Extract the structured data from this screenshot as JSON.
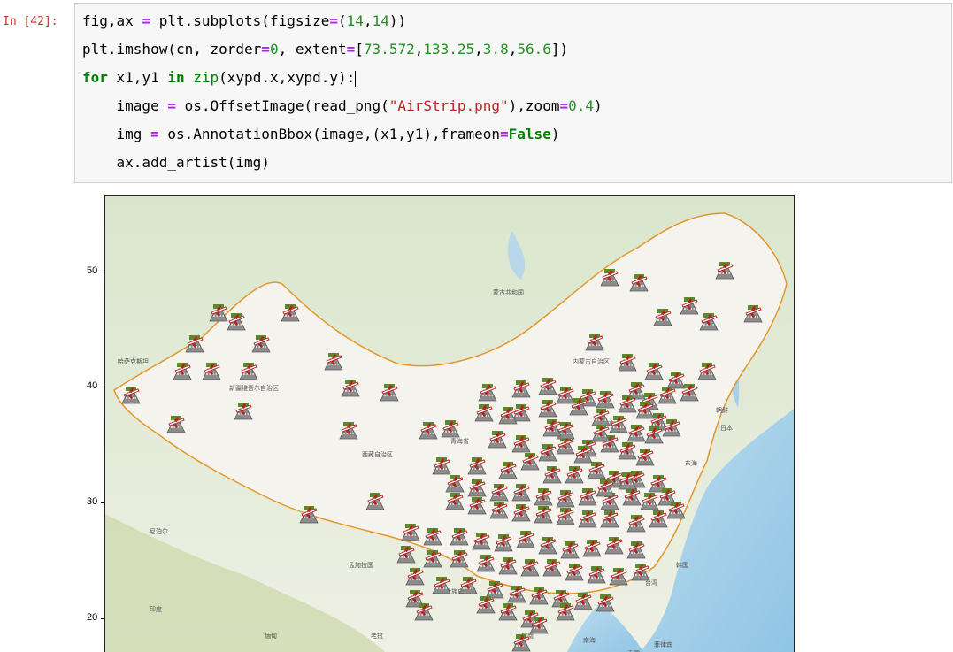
{
  "notebook": {
    "prompt": "In [42]:",
    "code_lines": [
      [
        {
          "t": "fig,ax "
        },
        {
          "t": "=",
          "c": "o"
        },
        {
          "t": " plt.subplots(figsize"
        },
        {
          "t": "=",
          "c": "o"
        },
        {
          "t": "("
        },
        {
          "t": "14",
          "c": "num"
        },
        {
          "t": ","
        },
        {
          "t": "14",
          "c": "num"
        },
        {
          "t": "))"
        }
      ],
      [
        {
          "t": "plt.imshow(cn, zorder"
        },
        {
          "t": "=",
          "c": "o"
        },
        {
          "t": "0",
          "c": "num"
        },
        {
          "t": ", extent"
        },
        {
          "t": "=",
          "c": "o"
        },
        {
          "t": "["
        },
        {
          "t": "73.572",
          "c": "num"
        },
        {
          "t": ","
        },
        {
          "t": "133.25",
          "c": "num"
        },
        {
          "t": ","
        },
        {
          "t": "3.8",
          "c": "num"
        },
        {
          "t": ","
        },
        {
          "t": "56.6",
          "c": "num"
        },
        {
          "t": "])"
        }
      ],
      [
        {
          "t": "for",
          "c": "k"
        },
        {
          "t": " x1,y1 "
        },
        {
          "t": "in",
          "c": "k"
        },
        {
          "t": " "
        },
        {
          "t": "zip",
          "c": "n"
        },
        {
          "t": "(xypd.x,xypd.y):"
        }
      ],
      [
        {
          "t": "    image "
        },
        {
          "t": "=",
          "c": "o"
        },
        {
          "t": " os.OffsetImage(read_png("
        },
        {
          "t": "\"AirStrip.png\"",
          "c": "s"
        },
        {
          "t": "),zoom"
        },
        {
          "t": "=",
          "c": "o"
        },
        {
          "t": "0.4",
          "c": "num"
        },
        {
          "t": ")"
        }
      ],
      [
        {
          "t": "    img "
        },
        {
          "t": "=",
          "c": "o"
        },
        {
          "t": " os.AnnotationBbox(image,(x1,y1),frameon"
        },
        {
          "t": "=",
          "c": "o"
        },
        {
          "t": "False",
          "c": "k"
        },
        {
          "t": ")"
        }
      ],
      [
        {
          "t": "    ax.add_artist(img)"
        }
      ]
    ]
  },
  "figure": {
    "y_ticks": [
      "50",
      "40",
      "30",
      "20"
    ],
    "map_labels": [
      "蒙古共和国",
      "哈萨克斯坦",
      "新疆维吾尔自治区",
      "内蒙古自治区",
      "西藏自治区",
      "青海省",
      "尼泊尔",
      "印度",
      "孟加拉国",
      "缅甸",
      "老挝",
      "越南",
      "泰国",
      "东海",
      "日本",
      "朝鲜",
      "韩国",
      "台湾",
      "南海",
      "菲律宾",
      "北京市",
      "广西壮族自治区"
    ],
    "airstrip_icon": "airstrip-icon",
    "colors": {
      "land": "#dfe6cf",
      "water": "#a9cfe6",
      "border": "#e5962b"
    }
  }
}
